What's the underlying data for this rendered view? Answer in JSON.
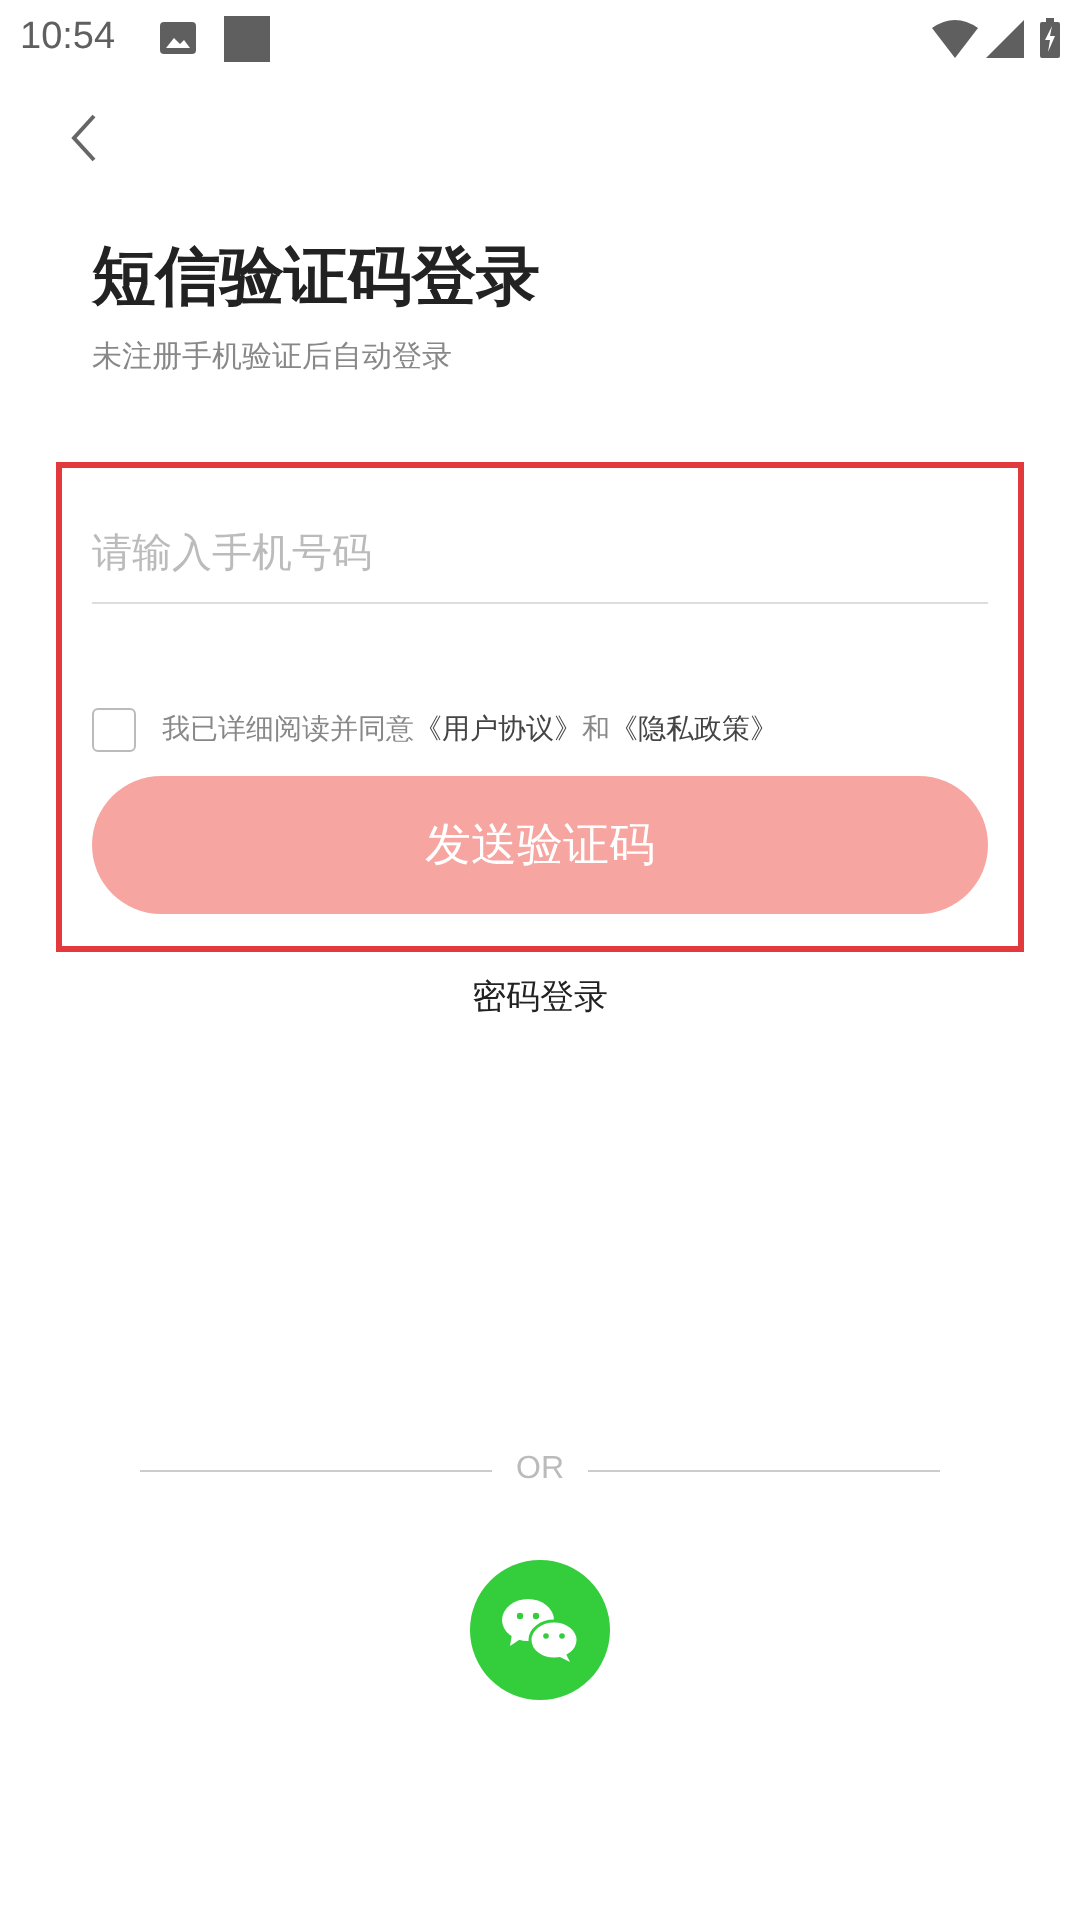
{
  "status_bar": {
    "time": "10:54"
  },
  "header": {
    "title": "短信验证码登录",
    "subtitle": "未注册手机验证后自动登录"
  },
  "phone_field": {
    "placeholder": "请输入手机号码"
  },
  "agreement": {
    "checked": false,
    "prefix": "我已详细阅读并同意",
    "link_1": "《用户协议》",
    "middle": "和",
    "link_2": "《隐私政策》"
  },
  "send_button": {
    "label": "发送验证码",
    "disabled": true
  },
  "password_login": "密码登录",
  "divider_label": "OR"
}
